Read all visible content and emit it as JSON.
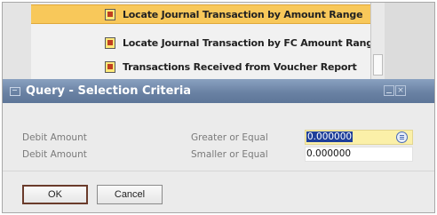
{
  "background_list": {
    "items": [
      {
        "label": "Locate Journal Transaction by Amount Range",
        "selected": true
      },
      {
        "label": "Locate Journal Transaction by FC Amount Range",
        "selected": false
      },
      {
        "label": "Transactions Received from Voucher Report",
        "selected": false
      }
    ]
  },
  "dialog": {
    "title": "Query - Selection Criteria",
    "rows": [
      {
        "field": "Debit Amount",
        "operator": "Greater or Equal",
        "value": "0.000000"
      },
      {
        "field": "Debit Amount",
        "operator": "Smaller or Equal",
        "value": "0.000000"
      }
    ],
    "ok_label": "OK",
    "cancel_label": "Cancel"
  },
  "colors": {
    "titlebar": "#6a82a4",
    "selected_row": "#f8c85a",
    "active_field": "#fbf0a8",
    "text_highlight": "#1f3f9a"
  },
  "icons": {
    "report_item": "report-icon",
    "title": "window-icon",
    "choose_from_list": "choose-from-list-icon"
  }
}
